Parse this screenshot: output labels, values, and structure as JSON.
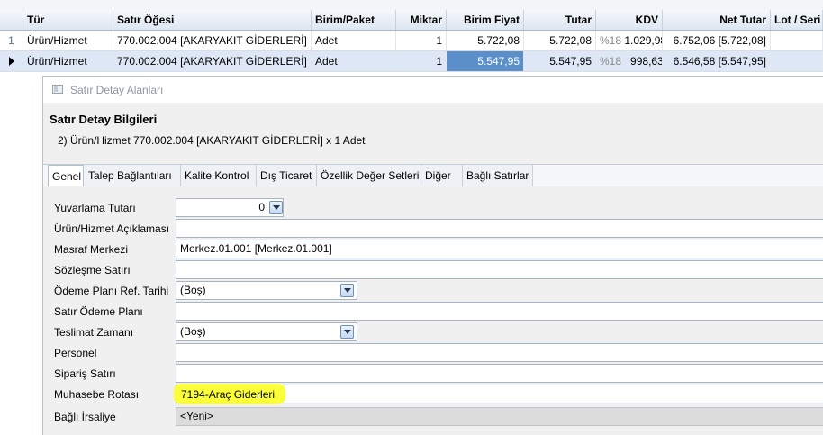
{
  "grid": {
    "columns": [
      "Tür",
      "Satır Öğesi",
      "Birim/Paket",
      "Miktar",
      "Birim Fiyat",
      "Tutar",
      "KDV",
      "Net Tutar",
      "Lot / Seri"
    ],
    "rows": [
      {
        "num": "1",
        "type": "Ürün/Hizmet",
        "item": "770.002.004 [AKARYAKIT GİDERLERİ]",
        "unit": "Adet",
        "qty": "1",
        "unit_price": "5.722,08",
        "total": "5.722,08",
        "vat_rate": "%18",
        "vat": "1.029,98",
        "net": "6.752,06 [5.722,08]"
      },
      {
        "num": "",
        "type": "Ürün/Hizmet",
        "item": "770.002.004 [AKARYAKIT GİDERLERİ]",
        "unit": "Adet",
        "qty": "1",
        "unit_price": "5.547,95",
        "total": "5.547,95",
        "vat_rate": "%18",
        "vat": "998,63",
        "net": "6.546,58 [5.547,95]"
      }
    ]
  },
  "dialog": {
    "window_title": "Satır Detay Alanları",
    "header_title": "Satır Detay Bilgileri",
    "header_subtitle": "2) Ürün/Hizmet 770.002.004 [AKARYAKIT GİDERLERİ] x 1 Adet",
    "tabs": [
      "Genel",
      "Talep Bağlantıları",
      "Kalite Kontrol",
      "Dış Ticaret",
      "Özellik Değer Setleri",
      "Diğer",
      "Bağlı Satırlar"
    ],
    "fields": {
      "yuvarlama": {
        "label": "Yuvarlama Tutarı",
        "value": "0"
      },
      "aciklama": {
        "label": "Ürün/Hizmet Açıklaması",
        "value": ""
      },
      "masraf": {
        "label": "Masraf Merkezi",
        "value": "Merkez.01.001 [Merkez.01.001]"
      },
      "sozlesme": {
        "label": "Sözleşme Satırı",
        "value": ""
      },
      "odeme_plani_ref": {
        "label": "Ödeme Planı Ref. Tarihi",
        "value": "(Boş)"
      },
      "satir_odeme": {
        "label": "Satır Ödeme Planı",
        "value": ""
      },
      "teslimat": {
        "label": "Teslimat Zamanı",
        "value": "(Boş)"
      },
      "personel": {
        "label": "Personel",
        "value": ""
      },
      "siparis": {
        "label": "Sipariş Satırı",
        "value": ""
      },
      "muhasebe": {
        "label": "Muhasebe Rotası",
        "value": "7194-Araç Giderleri"
      },
      "irsaliye": {
        "label": "Bağlı İrsaliye",
        "value": "<Yeni>"
      }
    }
  },
  "colors": {
    "selected_row": "#dde7f5",
    "selected_cell": "#5b8fc9",
    "highlight": "#fbff2e"
  },
  "icons": {
    "row_pointer": "triangle-right-icon",
    "combo": "chevron-down-icon"
  }
}
